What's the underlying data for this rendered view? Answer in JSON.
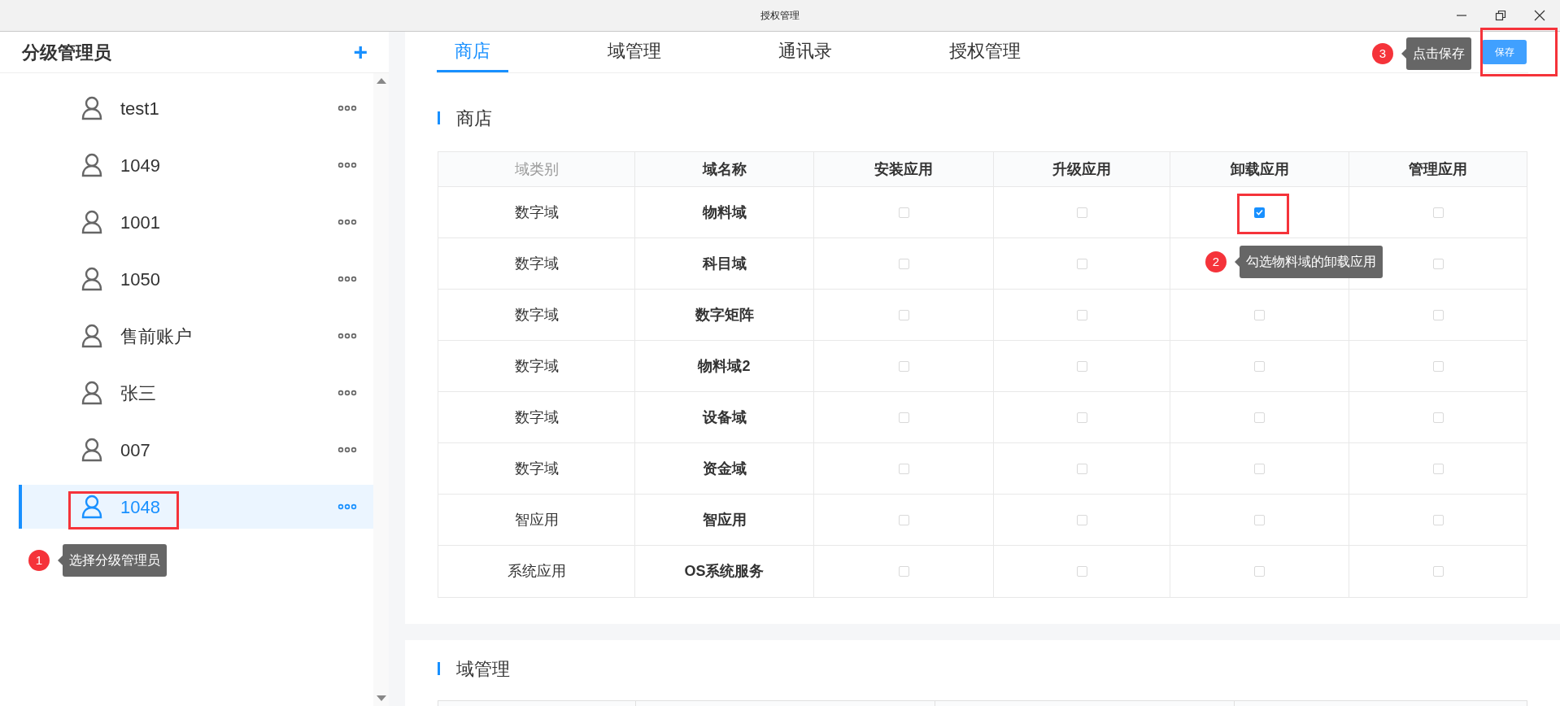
{
  "window": {
    "title": "授权管理"
  },
  "sidebar": {
    "title": "分级管理员",
    "add_label": "+",
    "items": [
      {
        "name": "test1",
        "selected": false
      },
      {
        "name": "1049",
        "selected": false
      },
      {
        "name": "1001",
        "selected": false
      },
      {
        "name": "1050",
        "selected": false
      },
      {
        "name": "售前账户",
        "selected": false
      },
      {
        "name": "张三",
        "selected": false
      },
      {
        "name": "007",
        "selected": false
      },
      {
        "name": "1048",
        "selected": true
      }
    ]
  },
  "tabs": [
    {
      "label": "商店",
      "selected": true
    },
    {
      "label": "域管理",
      "selected": false
    },
    {
      "label": "通讯录",
      "selected": false
    },
    {
      "label": "授权管理",
      "selected": false
    }
  ],
  "save_button": "保存",
  "sections": [
    {
      "title": "商店",
      "table": {
        "columns": [
          "域类别",
          "域名称",
          "安装应用",
          "升级应用",
          "卸载应用",
          "管理应用"
        ],
        "rows": [
          {
            "category": "数字域",
            "name": "物料域",
            "install": false,
            "upgrade": false,
            "uninstall": true,
            "manage": false
          },
          {
            "category": "数字域",
            "name": "科目域",
            "install": false,
            "upgrade": false,
            "manage": false
          },
          {
            "category": "数字域",
            "name": "数字矩阵",
            "install": false,
            "upgrade": false,
            "uninstall": false,
            "manage": false
          },
          {
            "category": "数字域",
            "name": "物料域2",
            "install": false,
            "upgrade": false,
            "uninstall": false,
            "manage": false
          },
          {
            "category": "数字域",
            "name": "设备域",
            "install": false,
            "upgrade": false,
            "uninstall": false,
            "manage": false
          },
          {
            "category": "数字域",
            "name": "资金域",
            "install": false,
            "upgrade": false,
            "uninstall": false,
            "manage": false
          },
          {
            "category": "智应用",
            "name": "智应用",
            "install": false,
            "upgrade": false,
            "uninstall": false,
            "manage": false
          },
          {
            "category": "系统应用",
            "name": "OS系统服务",
            "install": false,
            "upgrade": false,
            "uninstall": false,
            "manage": false
          }
        ]
      }
    },
    {
      "title": "域管理"
    }
  ],
  "annotations": [
    {
      "step": "1",
      "text": "选择分级管理员"
    },
    {
      "step": "2",
      "text": "勾选物料域的卸载应用"
    },
    {
      "step": "3",
      "text": "点击保存"
    }
  ]
}
